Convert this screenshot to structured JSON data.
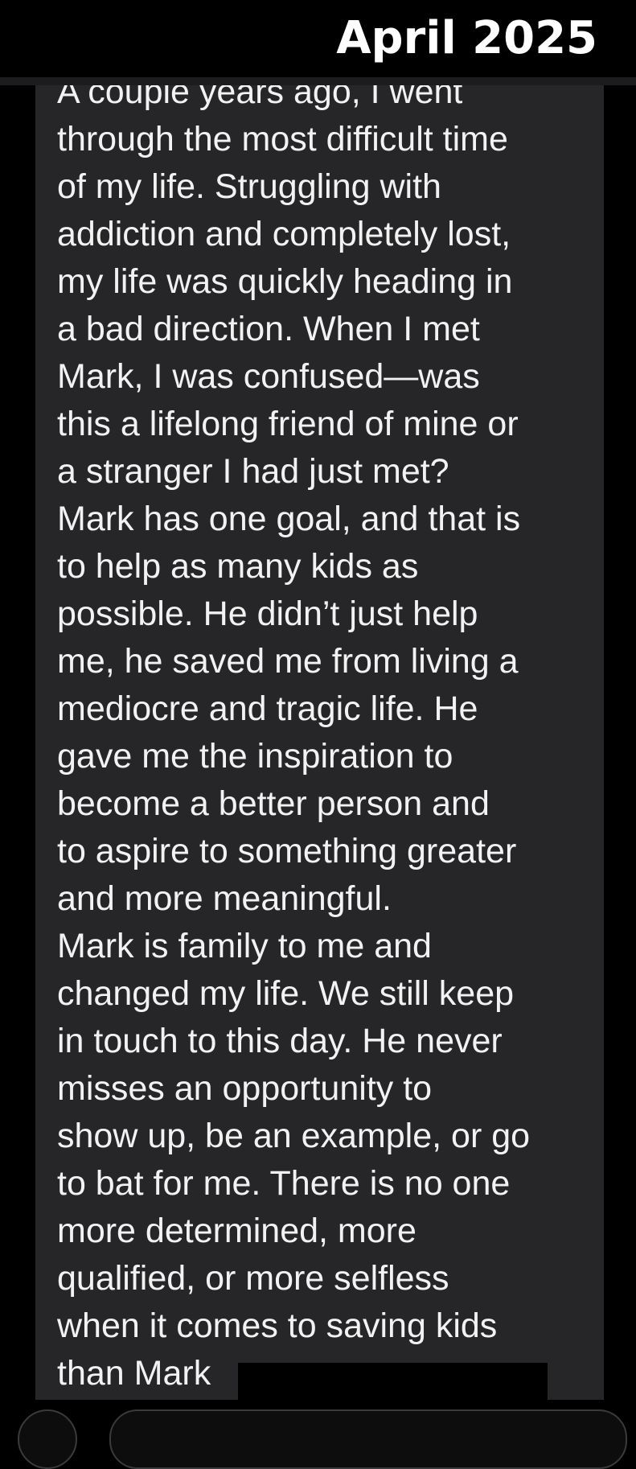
{
  "header": {
    "title": "April 2025"
  },
  "message": {
    "lines": [
      "A couple years ago, I went",
      "through the most difficult time",
      "of my life. Struggling with",
      "addiction and completely lost,",
      "my life was quickly heading in",
      "a bad direction. When I met",
      "Mark, I was confused—was",
      "this a lifelong friend of mine or",
      "a stranger I had just met?",
      "Mark has one goal, and that is",
      "to help as many kids as",
      "possible. He didn’t just help",
      "me, he saved me from living a",
      "mediocre and tragic life. He",
      "gave me the inspiration to",
      "become a better person and",
      "to aspire to something greater",
      "and more meaningful.",
      "Mark is family to me and",
      "changed my life. We still keep",
      "in touch to this day. He never",
      "misses an opportunity to",
      "show up, be an example, or go",
      "to bat for me. There is no one",
      "more determined, more",
      "qualified, or more selfless",
      "when it comes to saving kids",
      "than Mark"
    ]
  },
  "colors": {
    "background": "#000000",
    "bubble": "#262628",
    "text": "#f2f2f2",
    "header_text": "#ffffff"
  }
}
